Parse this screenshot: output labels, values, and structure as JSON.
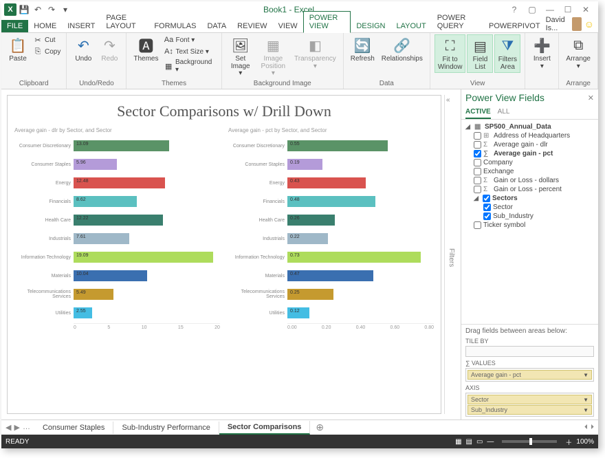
{
  "app": {
    "title": "Book1 - Excel",
    "user": "David Is..."
  },
  "qat": {
    "save": "💾",
    "undo": "↶",
    "redo": "↷"
  },
  "tabs": [
    "FILE",
    "HOME",
    "INSERT",
    "PAGE LAYOUT",
    "FORMULAS",
    "DATA",
    "REVIEW",
    "VIEW",
    "POWER VIEW",
    "DESIGN",
    "LAYOUT",
    "POWER QUERY",
    "POWERPIVOT"
  ],
  "activeTab": "POWER VIEW",
  "ribbon": {
    "clipboard": {
      "label": "Clipboard",
      "paste": "Paste",
      "cut": "Cut",
      "copy": "Copy"
    },
    "undoredo": {
      "label": "Undo/Redo",
      "undo": "Undo",
      "redo": "Redo"
    },
    "themes": {
      "label": "Themes",
      "themes": "Themes",
      "font": "Font ▾",
      "textsize": "Text Size ▾",
      "background": "Background ▾"
    },
    "bgimage": {
      "label": "Background Image",
      "set": "Set\nImage ▾",
      "image": "Image\nPosition ▾",
      "transparency": "Transparency\n▾"
    },
    "data": {
      "label": "Data",
      "refresh": "Refresh",
      "relationships": "Relationships"
    },
    "view": {
      "label": "View",
      "fit": "Fit to\nWindow",
      "fieldlist": "Field\nList",
      "filters": "Filters\nArea"
    },
    "insert": {
      "label": " ",
      "insert": "Insert\n▾"
    },
    "arrange": {
      "label": "Arrange",
      "arrange": "Arrange\n▾"
    }
  },
  "canvas": {
    "title": "Sector Comparisons w/ Drill Down",
    "filtersLabel": "Filters",
    "chart_data": [
      {
        "type": "bar",
        "title": "Average gain - dlr by Sector, and Sector",
        "categories": [
          "Consumer Discretionary",
          "Consumer Staples",
          "Energy",
          "Financials",
          "Health Care",
          "Industrials",
          "Information Technology",
          "Materials",
          "Telecommunications Services",
          "Utilities"
        ],
        "values": [
          13.09,
          5.96,
          12.48,
          8.62,
          12.22,
          7.61,
          19.09,
          10.04,
          5.49,
          2.55
        ],
        "colors": [
          "#5a9367",
          "#b49bd9",
          "#d9534f",
          "#5bc0c0",
          "#3a7f6e",
          "#9fb8c8",
          "#aedc5c",
          "#3a6fb0",
          "#c59a2f",
          "#44bde3"
        ],
        "xticks": [
          "0",
          "5",
          "10",
          "15",
          "20"
        ],
        "xmax": 20
      },
      {
        "type": "bar",
        "title": "Average gain - pct by Sector, and Sector",
        "categories": [
          "Consumer Discretionary",
          "Consumer Staples",
          "Energy",
          "Financials",
          "Health Care",
          "Industrials",
          "Information Technology",
          "Materials",
          "Telecommunications Services",
          "Utilities"
        ],
        "values": [
          0.55,
          0.19,
          0.43,
          0.48,
          0.26,
          0.22,
          0.73,
          0.47,
          0.25,
          0.12
        ],
        "colors": [
          "#5a9367",
          "#b49bd9",
          "#d9534f",
          "#5bc0c0",
          "#3a7f6e",
          "#9fb8c8",
          "#aedc5c",
          "#3a6fb0",
          "#c59a2f",
          "#44bde3"
        ],
        "xticks": [
          "0.00",
          "0.20",
          "0.40",
          "0.60",
          "0.80"
        ],
        "xmax": 0.8
      }
    ]
  },
  "fieldlist": {
    "title": "Power View Fields",
    "tabs": {
      "active": "ACTIVE",
      "all": "ALL"
    },
    "table": "SP500_Annual_Data",
    "fields": [
      {
        "label": "Address of Headquarters",
        "checked": false,
        "icon": "⊞"
      },
      {
        "label": "Average gain - dlr",
        "checked": false,
        "icon": "Σ"
      },
      {
        "label": "Average gain - pct",
        "checked": true,
        "icon": "∑",
        "bold": true
      },
      {
        "label": "Company",
        "checked": false
      },
      {
        "label": "Exchange",
        "checked": false
      },
      {
        "label": "Gain or Loss - dollars",
        "checked": false,
        "icon": "Σ"
      },
      {
        "label": "Gain or Loss - percent",
        "checked": false,
        "icon": "Σ"
      }
    ],
    "sectors": {
      "label": "Sectors",
      "checked": true,
      "children": [
        {
          "label": "Sector",
          "checked": true
        },
        {
          "label": "Sub_Industry",
          "checked": true
        }
      ]
    },
    "ticker": {
      "label": "Ticker symbol",
      "checked": false
    },
    "dragHint": "Drag fields between areas below:",
    "areas": {
      "tileby": {
        "label": "TILE BY"
      },
      "values": {
        "label": "∑ VALUES",
        "items": [
          "Average gain - pct"
        ]
      },
      "axis": {
        "label": "AXIS",
        "items": [
          "Sector",
          "Sub_Industry"
        ]
      }
    }
  },
  "sheets": {
    "tabs": [
      "Consumer Staples",
      "Sub-Industry Performance",
      "Sector Comparisons"
    ],
    "active": "Sector Comparisons"
  },
  "status": {
    "ready": "READY",
    "zoom": "100%"
  }
}
